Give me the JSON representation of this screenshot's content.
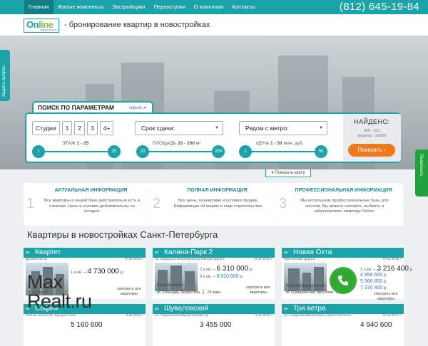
{
  "nav": {
    "items": [
      "Главная",
      "Жилые комплексы",
      "Застройщики",
      "Переуступки",
      "О компании",
      "Контакты"
    ],
    "phone": "(812) 645-19-84"
  },
  "logo": {
    "text_a": "On",
    "text_b": "line",
    "sub": "недвижимость"
  },
  "tagline": "- бронирование квартир в новостройках",
  "side": {
    "left": "Задать вопрос",
    "right": "Позвонить"
  },
  "search": {
    "title": "ПОИСК ПО ПАРАМЕТРАМ",
    "hide": "скрыть",
    "rooms": [
      "Студии",
      "1",
      "2",
      "3",
      "4+"
    ],
    "deadline": "Срок сдачи:",
    "metro": "Рядом с метро:",
    "floor": {
      "label": "ЭТАЖ",
      "range": "1 - 25",
      "min": "1",
      "max": "25"
    },
    "area": {
      "label": "ПЛОЩАДЬ",
      "range": "20 - 200",
      "unit": "м²",
      "min": "20",
      "max": "200"
    },
    "price": {
      "label": "ЦЕНА",
      "range": "1 - 50",
      "unit": "млн. руб.",
      "min": "1",
      "max": "50"
    },
    "found": {
      "title": "НАЙДЕНО:",
      "complexes": "ЖК - 231",
      "apartments": "квартир - 51665",
      "button": "Показать"
    },
    "show_map": "Показать карту"
  },
  "info": [
    {
      "num": "1",
      "title": "АКТУАЛЬНАЯ ИНФОРМАЦИЯ",
      "text": "Все квартиры в нашей базе действительно есть в наличии. Цены и условия действительны на сегодня."
    },
    {
      "num": "2",
      "title": "ПОЛНАЯ ИНФОРМАЦИЯ",
      "text": "Все цены, планировки и условия продаж. Информация об акциях и ходе строительства."
    },
    {
      "num": "3",
      "title": "ПРОФЕССИОНАЛЬНАЯ ИНФОРМАЦИЯ",
      "text": "Мы используем профессиональные базы для агентов. Вы можете смотреть, выбрать и забронировать квартиру Online."
    }
  ],
  "section_title": "Квартиры в новостройках Санкт-Петербурга",
  "cards": [
    {
      "prefix": "жк",
      "name": "Квартет",
      "address": "Дунайский пр",
      "date": "IV кв 2016 г.",
      "prices": [
        {
          "rooms": "1 к.кв. –",
          "value": "4 730 000",
          "unit": "р."
        }
      ],
      "district": "",
      "metro": "Купчино",
      "see": "смотреть все квартиры"
    },
    {
      "prefix": "жк",
      "name": "Калина-Парк 2",
      "address": "пр. Маршала Блюхера/Кушелевская дорога",
      "date": "III кв 2016 г.",
      "prices": [
        {
          "rooms": "2 к.кв. –",
          "value": "6 310 000",
          "unit": "р."
        },
        {
          "rooms": "3 к.кв. –",
          "value": "8 010 000",
          "unit": "р."
        }
      ],
      "district": "Калининский",
      "metro": "Площадь Мужества",
      "walk": "25 мин.",
      "see": "смотреть все квартиры"
    },
    {
      "prefix": "жк",
      "name": "Новая Охта",
      "address": "Мурнинская дорога",
      "date": "IV кв 2016 г.",
      "prices": [
        {
          "rooms": "1 к.кв. –",
          "value": "3 216 400",
          "unit": "р."
        },
        {
          "rooms": "",
          "value": "4 958 600",
          "unit": "р."
        },
        {
          "rooms": "",
          "value": "5 566 850",
          "unit": "р."
        },
        {
          "rooms": "",
          "value": "7 370 400",
          "unit": "р."
        }
      ],
      "district": "Красногвардейский",
      "metro": "Гражданский проспект",
      "walk": "29",
      "see": "смотреть все квартиры"
    },
    {
      "prefix": "жк",
      "name": "София",
      "address": "Южное шоссе/пр. Бухарестская",
      "date": "II кв 2016 г.",
      "price": "5 160 600"
    },
    {
      "prefix": "жк",
      "name": "Шуваловский",
      "address": "ул. Парашютная/Шуваловский пр",
      "date": "II кв 2016 г.",
      "price": "3 455 000"
    },
    {
      "prefix": "жк",
      "name": "Три ветра",
      "address": "ул. Савушкина/Березовая линия Финского",
      "date": "IV кв 2017 г.",
      "price": "4 940 600"
    }
  ],
  "watermark": {
    "line1": "Max",
    "line2": "Realt.ru"
  }
}
